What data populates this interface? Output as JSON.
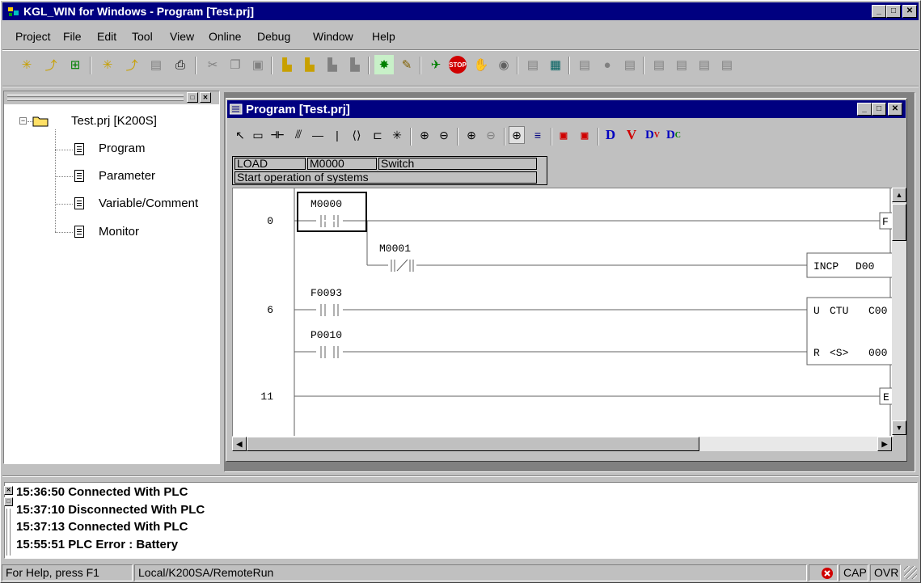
{
  "window": {
    "title": "KGL_WIN for Windows - Program [Test.prj]"
  },
  "menu": {
    "items": [
      "Project",
      "File",
      "Edit",
      "Tool",
      "View",
      "Online",
      "Debug",
      "Window",
      "Help"
    ]
  },
  "tree": {
    "root": "Test.prj [K200S]",
    "children": [
      "Program",
      "Parameter",
      "Variable/Comment",
      "Monitor"
    ]
  },
  "child": {
    "title": "Program [Test.prj]"
  },
  "ladder_toolbar": {
    "letters": [
      "D",
      "V",
      "D",
      "D"
    ],
    "subs": [
      "",
      "",
      "V",
      "C"
    ]
  },
  "infobox": {
    "instruction": "LOAD",
    "operand": "M0000",
    "comment": "Switch",
    "description": "Start operation of systems"
  },
  "ladder": {
    "step_labels": [
      "0",
      "6",
      "11"
    ],
    "contact_labels": [
      "M0000",
      "M0001",
      "F0093",
      "P0010"
    ],
    "box1": {
      "op": "INCP",
      "arg": "D00"
    },
    "box2": {
      "row1": [
        "U",
        "CTU",
        "C00"
      ],
      "row2": [
        "R",
        "<S>",
        "000"
      ]
    },
    "out_top": "F",
    "out_end": "E"
  },
  "messages": [
    "15:36:50 Connected With PLC",
    "15:37:10 Disconnected With PLC",
    "15:37:13 Connected With PLC",
    "15:55:51 PLC Error : Battery"
  ],
  "status": {
    "help": "For Help, press F1",
    "mode": "Local/K200SA/RemoteRun",
    "cap": "CAP",
    "ovr": "OVR"
  },
  "colors": {
    "titlebar": "#000080",
    "face": "#c0c0c0",
    "ladder_bg": "#ffffff"
  }
}
